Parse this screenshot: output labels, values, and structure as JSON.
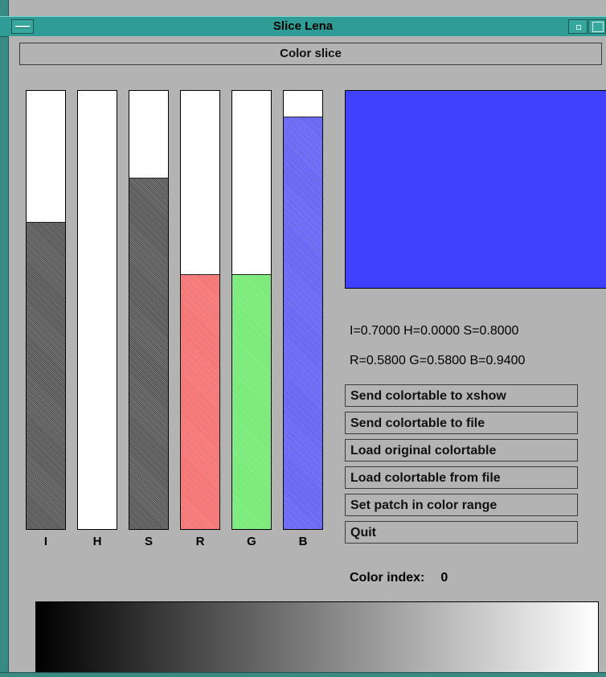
{
  "window": {
    "title": "Slice Lena"
  },
  "header": {
    "label": "Color slice"
  },
  "sliders": [
    {
      "label": "I",
      "value": 0.7,
      "color": "#6e6e6e"
    },
    {
      "label": "H",
      "value": 0.0,
      "color": "#6e6e6e"
    },
    {
      "label": "S",
      "value": 0.8,
      "color": "#6e6e6e"
    },
    {
      "label": "R",
      "value": 0.58,
      "color": "#ff6b6b"
    },
    {
      "label": "G",
      "value": 0.58,
      "color": "#6ff06f"
    },
    {
      "label": "B",
      "value": 0.94,
      "color": "#5b5bff"
    }
  ],
  "swatch": {
    "color": "#4040ff"
  },
  "readout": {
    "ihs": "I=0.7000 H=0.0000 S=0.8000",
    "rgb": "R=0.5800 G=0.5800 B=0.9400"
  },
  "actions": [
    "Send colortable to xshow",
    "Send colortable to file",
    "Load original colortable",
    "Load colortable from file",
    "Set patch in color range",
    "Quit"
  ],
  "color_index": {
    "label": "Color index:",
    "value": "0"
  }
}
